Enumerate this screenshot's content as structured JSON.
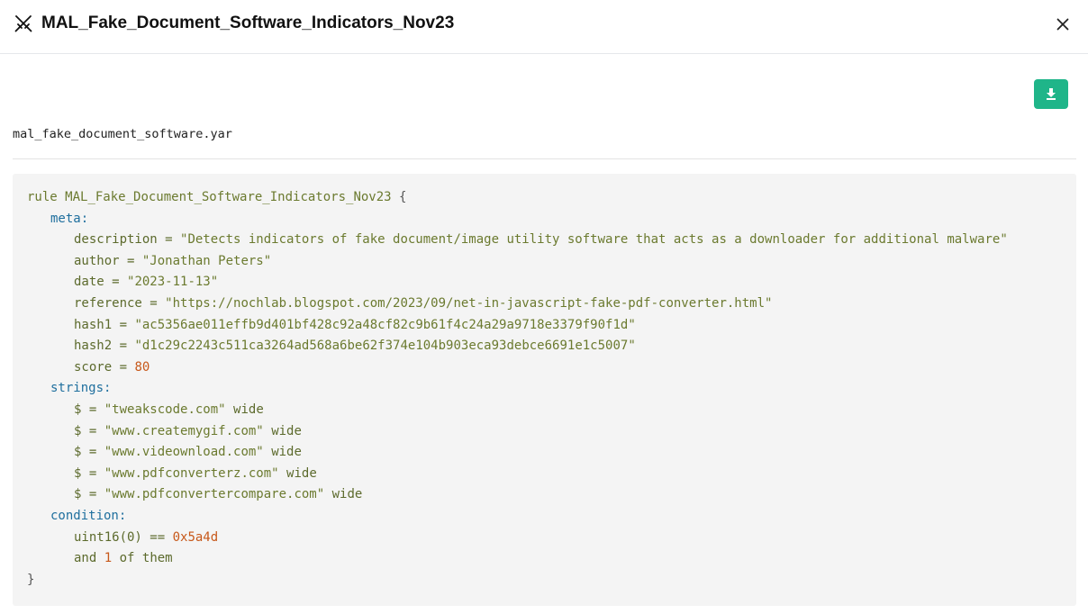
{
  "header": {
    "title": "MAL_Fake_Document_Software_Indicators_Nov23",
    "icon": "swords-icon",
    "close_icon": "close-icon"
  },
  "toolbar": {
    "download_icon": "download-icon",
    "accent_color": "#1fb589"
  },
  "file": {
    "name": "mal_fake_document_software.yar"
  },
  "rule": {
    "header_keyword": "rule",
    "name": "MAL_Fake_Document_Software_Indicators_Nov23",
    "open_brace": "{",
    "close_brace": "}",
    "meta_label": "meta:",
    "meta": [
      {
        "key": "description",
        "value": "\"Detects indicators of fake document/image utility software that acts as a downloader for additional malware\""
      },
      {
        "key": "author",
        "value": "\"Jonathan Peters\""
      },
      {
        "key": "date",
        "value": "\"2023-11-13\""
      },
      {
        "key": "reference",
        "value": "\"https://nochlab.blogspot.com/2023/09/net-in-javascript-fake-pdf-converter.html\""
      },
      {
        "key": "hash1",
        "value": "\"ac5356ae011effb9d401bf428c92a48cf82c9b61f4c24a29a9718e3379f90f1d\""
      },
      {
        "key": "hash2",
        "value": "\"d1c29c2243c511ca3264ad568a6be62f374e104b903eca93debce6691e1c5007\""
      },
      {
        "key": "score",
        "value": "80"
      }
    ],
    "strings_label": "strings:",
    "strings": [
      {
        "var": "$",
        "value": "\"tweakscode.com\"",
        "modifier": "wide"
      },
      {
        "var": "$",
        "value": "\"www.createmygif.com\"",
        "modifier": "wide"
      },
      {
        "var": "$",
        "value": "\"www.videownload.com\"",
        "modifier": "wide"
      },
      {
        "var": "$",
        "value": "\"www.pdfconverterz.com\"",
        "modifier": "wide"
      },
      {
        "var": "$",
        "value": "\"www.pdfconvertercompare.com\"",
        "modifier": "wide"
      }
    ],
    "condition_label": "condition:",
    "condition": {
      "line1_func": "uint16(0) ==",
      "line1_value": "0x5a4d",
      "line2_and": "and",
      "line2_count": "1",
      "line2_rest": "of them"
    }
  },
  "colors": {
    "code_background": "#f4f4f4",
    "section_label": "#1f6f9e",
    "string_literal": "#6b7a2f",
    "number_literal": "#c7581a"
  }
}
